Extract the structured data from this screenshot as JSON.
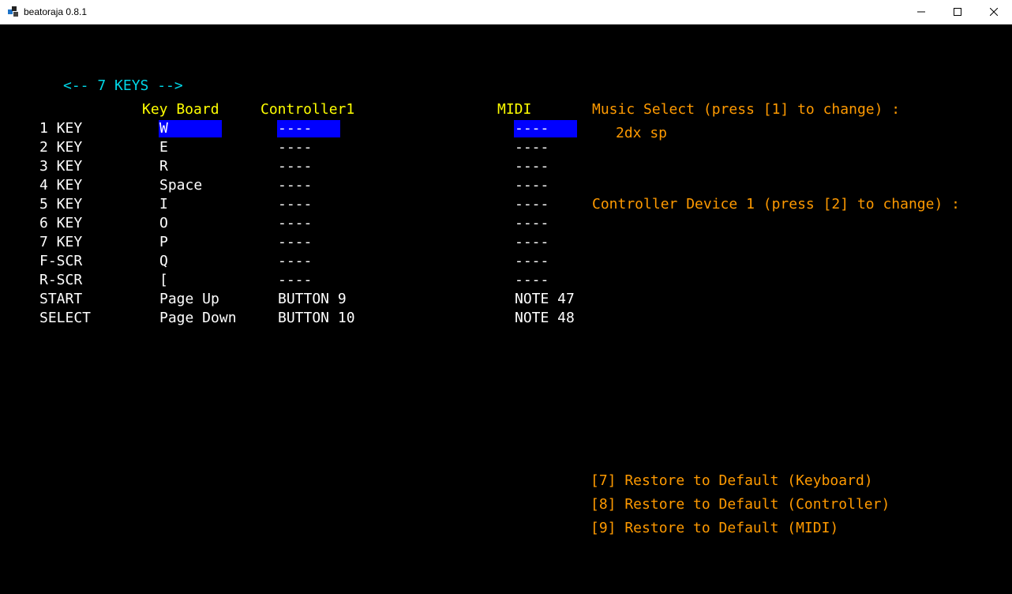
{
  "window": {
    "title": "beatoraja 0.8.1"
  },
  "mode_label": "<-- 7 KEYS -->",
  "headers": {
    "keyboard": "Key Board",
    "controller": "Controller1",
    "midi": "MIDI"
  },
  "rows": [
    {
      "label": "1 KEY",
      "keyboard": "W",
      "controller": "----",
      "midi": "----"
    },
    {
      "label": "2 KEY",
      "keyboard": "E",
      "controller": "----",
      "midi": "----"
    },
    {
      "label": "3 KEY",
      "keyboard": "R",
      "controller": "----",
      "midi": "----"
    },
    {
      "label": "4 KEY",
      "keyboard": "Space",
      "controller": "----",
      "midi": "----"
    },
    {
      "label": "5 KEY",
      "keyboard": "I",
      "controller": "----",
      "midi": "----"
    },
    {
      "label": "6 KEY",
      "keyboard": "O",
      "controller": "----",
      "midi": "----"
    },
    {
      "label": "7 KEY",
      "keyboard": "P",
      "controller": "----",
      "midi": "----"
    },
    {
      "label": "F-SCR",
      "keyboard": "Q",
      "controller": "----",
      "midi": "----"
    },
    {
      "label": "R-SCR",
      "keyboard": "[",
      "controller": "----",
      "midi": "----"
    },
    {
      "label": "START",
      "keyboard": "Page Up",
      "controller": "BUTTON 9",
      "midi": "NOTE 47"
    },
    {
      "label": "SELECT",
      "keyboard": "Page Down",
      "controller": "BUTTON 10",
      "midi": "NOTE 48"
    }
  ],
  "selected_row": 0,
  "music_select": {
    "label": "Music Select (press [1] to change) :",
    "value": "2dx sp"
  },
  "controller_device": {
    "label": "Controller Device 1 (press [2] to change) :"
  },
  "restore": {
    "keyboard": "[7] Restore to Default (Keyboard)",
    "controller": "[8] Restore to Default (Controller)",
    "midi": "[9] Restore to Default (MIDI)"
  },
  "colors": {
    "background": "#000000",
    "text": "#ffffff",
    "header": "#ffff00",
    "mode": "#00d8e8",
    "info": "#ff9a00",
    "highlight": "#0000ff"
  }
}
